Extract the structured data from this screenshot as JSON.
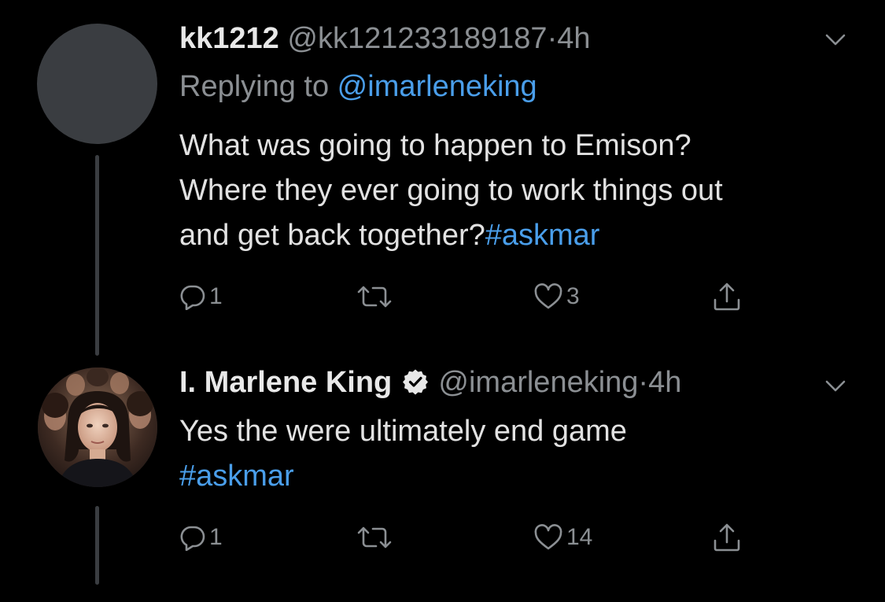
{
  "tweets": [
    {
      "author_name": "kk1212",
      "handle": "@kk121233189187",
      "separator": "·",
      "time": "4h",
      "replying_label": "Replying to ",
      "replying_to": "@imarleneking",
      "text_lines": [
        "What was going to happen to Emison?",
        "Where they ever going to work things out",
        "and get back together?"
      ],
      "hashtag": "#askmar",
      "reply_count": "1",
      "retweet_count": "",
      "like_count": "3"
    },
    {
      "author_name": "I. Marlene King",
      "verified": true,
      "handle": "@imarleneking",
      "separator": "·",
      "time": "4h",
      "text": "Yes the were ultimately end game",
      "hashtag": "#askmar",
      "reply_count": "1",
      "retweet_count": "",
      "like_count": "14"
    }
  ],
  "colors": {
    "background": "#000000",
    "text": "#e2e2e2",
    "secondary": "#8b8f93",
    "link": "#4a9eea"
  },
  "icons": [
    "reply-icon",
    "retweet-icon",
    "like-icon",
    "share-icon",
    "chevron-down-icon",
    "verified-badge-icon"
  ]
}
